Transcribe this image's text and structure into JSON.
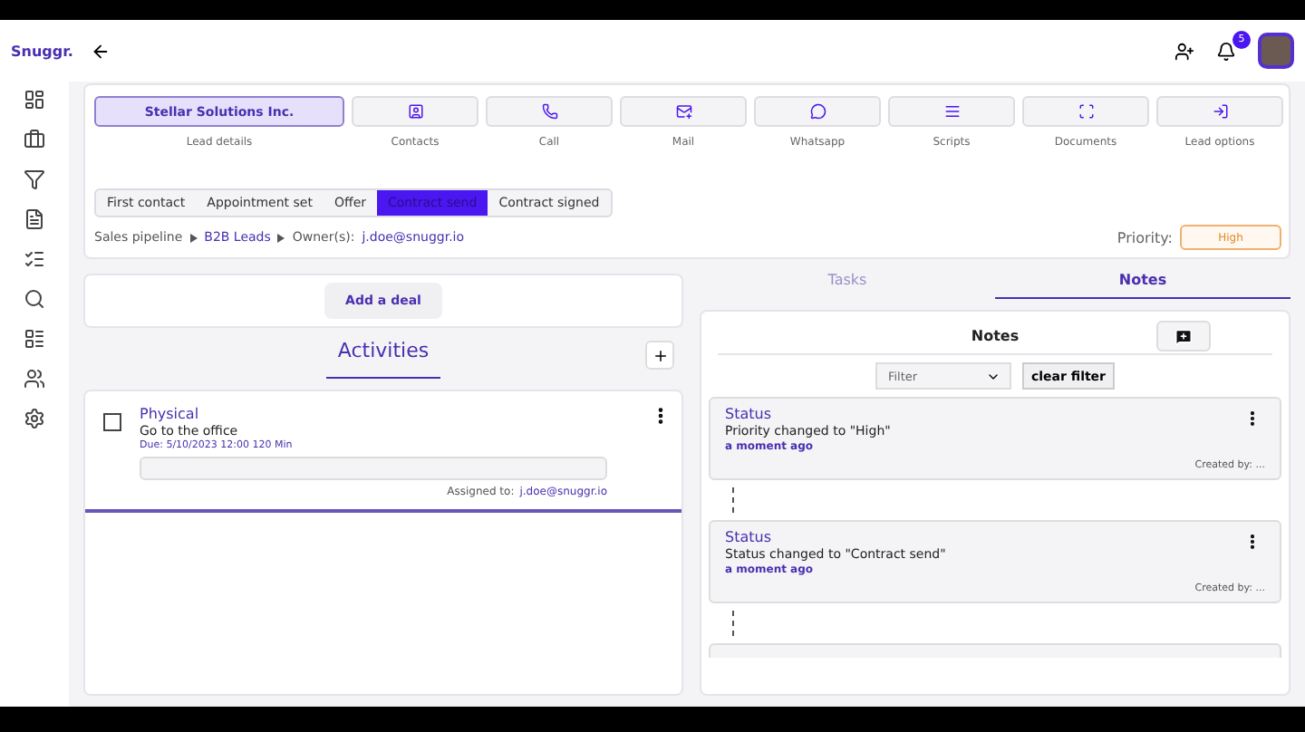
{
  "brand": "Snuggr.",
  "header": {
    "notification_count": "5"
  },
  "actions": [
    {
      "label": "Stellar Solutions Inc.",
      "caption": "Lead details",
      "kind": "name",
      "selected": true
    },
    {
      "caption": "Contacts",
      "kind": "contacts",
      "selected": false
    },
    {
      "caption": "Call",
      "kind": "call",
      "selected": false
    },
    {
      "caption": "Mail",
      "kind": "mail",
      "selected": false
    },
    {
      "caption": "Whatsapp",
      "kind": "whatsapp",
      "selected": false
    },
    {
      "caption": "Scripts",
      "kind": "scripts",
      "selected": false
    },
    {
      "caption": "Documents",
      "kind": "documents",
      "selected": false
    },
    {
      "caption": "Lead options",
      "kind": "options",
      "selected": false
    }
  ],
  "stages": [
    {
      "label": "First contact",
      "selected": false
    },
    {
      "label": "Appointment set",
      "selected": false
    },
    {
      "label": "Offer",
      "selected": false
    },
    {
      "label": "Contract send",
      "selected": true
    },
    {
      "label": "Contract signed",
      "selected": false
    }
  ],
  "breadcrumb": {
    "pipeline": "Sales pipeline",
    "board": "B2B Leads",
    "owner_label": "Owner(s):",
    "owner": "j.doe@snuggr.io"
  },
  "priority": {
    "label": "Priority:",
    "value": "High"
  },
  "add_deal": "Add a deal",
  "activities": {
    "title": "Activities",
    "items": [
      {
        "type": "Physical",
        "title": "Go to the office",
        "due": "Due: 5/10/2023  12:00  120  Min",
        "checked": false,
        "assigned_label": "Assigned to:",
        "assigned": "j.doe@snuggr.io"
      }
    ]
  },
  "tabs": [
    {
      "label": "Tasks",
      "selected": false
    },
    {
      "label": "Notes",
      "selected": true
    }
  ],
  "notes": {
    "title": "Notes",
    "filter": {
      "placeholder": "Filter"
    },
    "clear": "clear filter",
    "items": [
      {
        "title": "Status",
        "text": "Priority changed to \"High\"",
        "time": "a moment ago",
        "created": "Created by: ..."
      },
      {
        "title": "Status",
        "text": "Status changed to \"Contract send\"",
        "time": "a moment ago",
        "created": "Created by: ..."
      }
    ]
  }
}
